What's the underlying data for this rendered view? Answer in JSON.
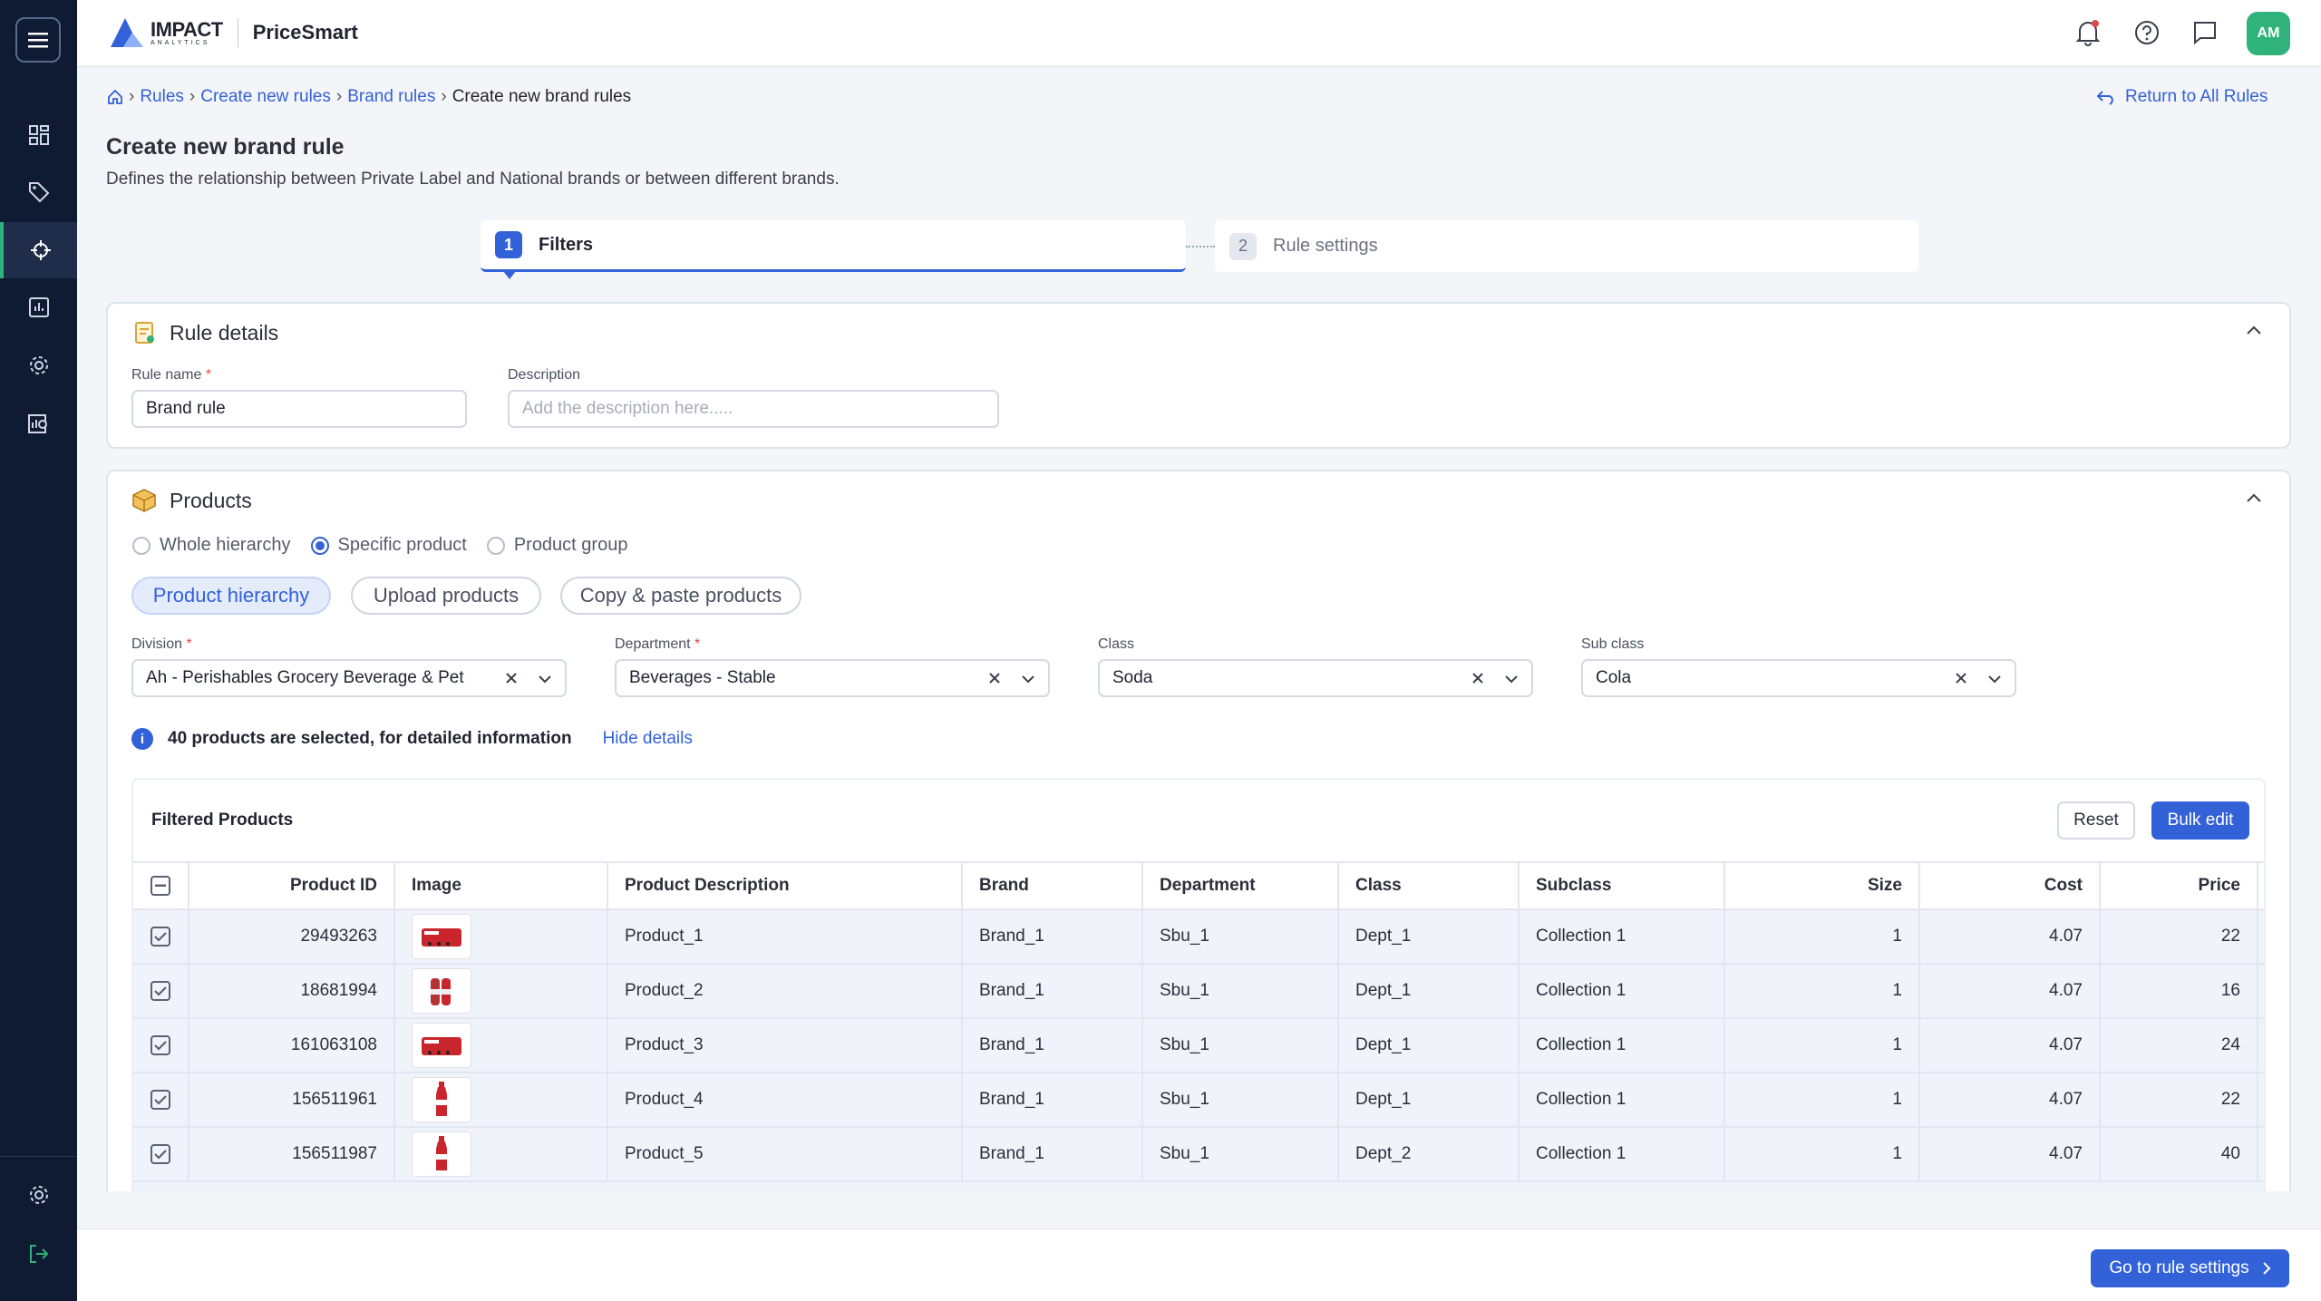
{
  "header": {
    "logo_text": "IMPACT",
    "logo_sub": "ANALYTICS",
    "app_name": "PriceSmart",
    "avatar": "AM"
  },
  "sidebar": {
    "items": [
      {
        "icon": "dashboard-icon"
      },
      {
        "icon": "tag-icon"
      },
      {
        "icon": "crosshair-icon",
        "active": true
      },
      {
        "icon": "report-icon"
      },
      {
        "icon": "settings-icon"
      },
      {
        "icon": "analytics-icon"
      }
    ],
    "bottom": [
      {
        "icon": "settings-icon"
      },
      {
        "icon": "logout-icon"
      }
    ]
  },
  "breadcrumb": {
    "items": [
      "Rules",
      "Create new rules",
      "Brand rules"
    ],
    "current": "Create new brand rules",
    "return_label": "Return to All Rules"
  },
  "page": {
    "title": "Create new brand rule",
    "description": "Defines the relationship between Private Label and National brands or between different brands."
  },
  "stepper": {
    "steps": [
      {
        "num": "1",
        "label": "Filters"
      },
      {
        "num": "2",
        "label": "Rule settings"
      }
    ]
  },
  "rule_details": {
    "title": "Rule details",
    "name_label": "Rule name",
    "name_value": "Brand rule",
    "desc_label": "Description",
    "desc_placeholder": "Add the description here....."
  },
  "products": {
    "title": "Products",
    "radios": [
      "Whole hierarchy",
      "Specific product",
      "Product group"
    ],
    "selected_radio": "Specific product",
    "tabs": [
      "Product hierarchy",
      "Upload products",
      "Copy & paste products"
    ],
    "filters": [
      {
        "label": "Division",
        "required": true,
        "value": "Ah - Perishables Grocery Beverage & Pet"
      },
      {
        "label": "Department",
        "required": true,
        "value": "Beverages - Stable"
      },
      {
        "label": "Class",
        "required": false,
        "value": "Soda"
      },
      {
        "label": "Sub class",
        "required": false,
        "value": "Cola"
      }
    ],
    "info_text": "40 products are selected, for detailed information",
    "hide_details": "Hide details"
  },
  "filtered": {
    "title": "Filtered Products",
    "reset": "Reset",
    "bulk_edit": "Bulk edit",
    "columns": [
      "Product ID",
      "Image",
      "Product Description",
      "Brand",
      "Department",
      "Class",
      "Subclass",
      "Size",
      "Cost",
      "Price"
    ],
    "rows": [
      {
        "id": "29493263",
        "desc": "Product_1",
        "brand": "Brand_1",
        "dept": "Sbu_1",
        "class": "Dept_1",
        "subclass": "Collection 1",
        "size": "1",
        "cost": "4.07",
        "price": "22",
        "img": "pack"
      },
      {
        "id": "18681994",
        "desc": "Product_2",
        "brand": "Brand_1",
        "dept": "Sbu_1",
        "class": "Dept_1",
        "subclass": "Collection 1",
        "size": "1",
        "cost": "4.07",
        "price": "16",
        "img": "multi"
      },
      {
        "id": "161063108",
        "desc": "Product_3",
        "brand": "Brand_1",
        "dept": "Sbu_1",
        "class": "Dept_1",
        "subclass": "Collection 1",
        "size": "1",
        "cost": "4.07",
        "price": "24",
        "img": "pack"
      },
      {
        "id": "156511961",
        "desc": "Product_4",
        "brand": "Brand_1",
        "dept": "Sbu_1",
        "class": "Dept_1",
        "subclass": "Collection 1",
        "size": "1",
        "cost": "4.07",
        "price": "22",
        "img": "bottle"
      },
      {
        "id": "156511987",
        "desc": "Product_5",
        "brand": "Brand_1",
        "dept": "Sbu_1",
        "class": "Dept_2",
        "subclass": "Collection 1",
        "size": "1",
        "cost": "4.07",
        "price": "40",
        "img": "bottle"
      }
    ]
  },
  "footer": {
    "next_label": "Go to rule settings"
  },
  "colors": {
    "primary": "#3361d8",
    "sidebar": "#0f1b33",
    "accent_green": "#2fb37a"
  }
}
